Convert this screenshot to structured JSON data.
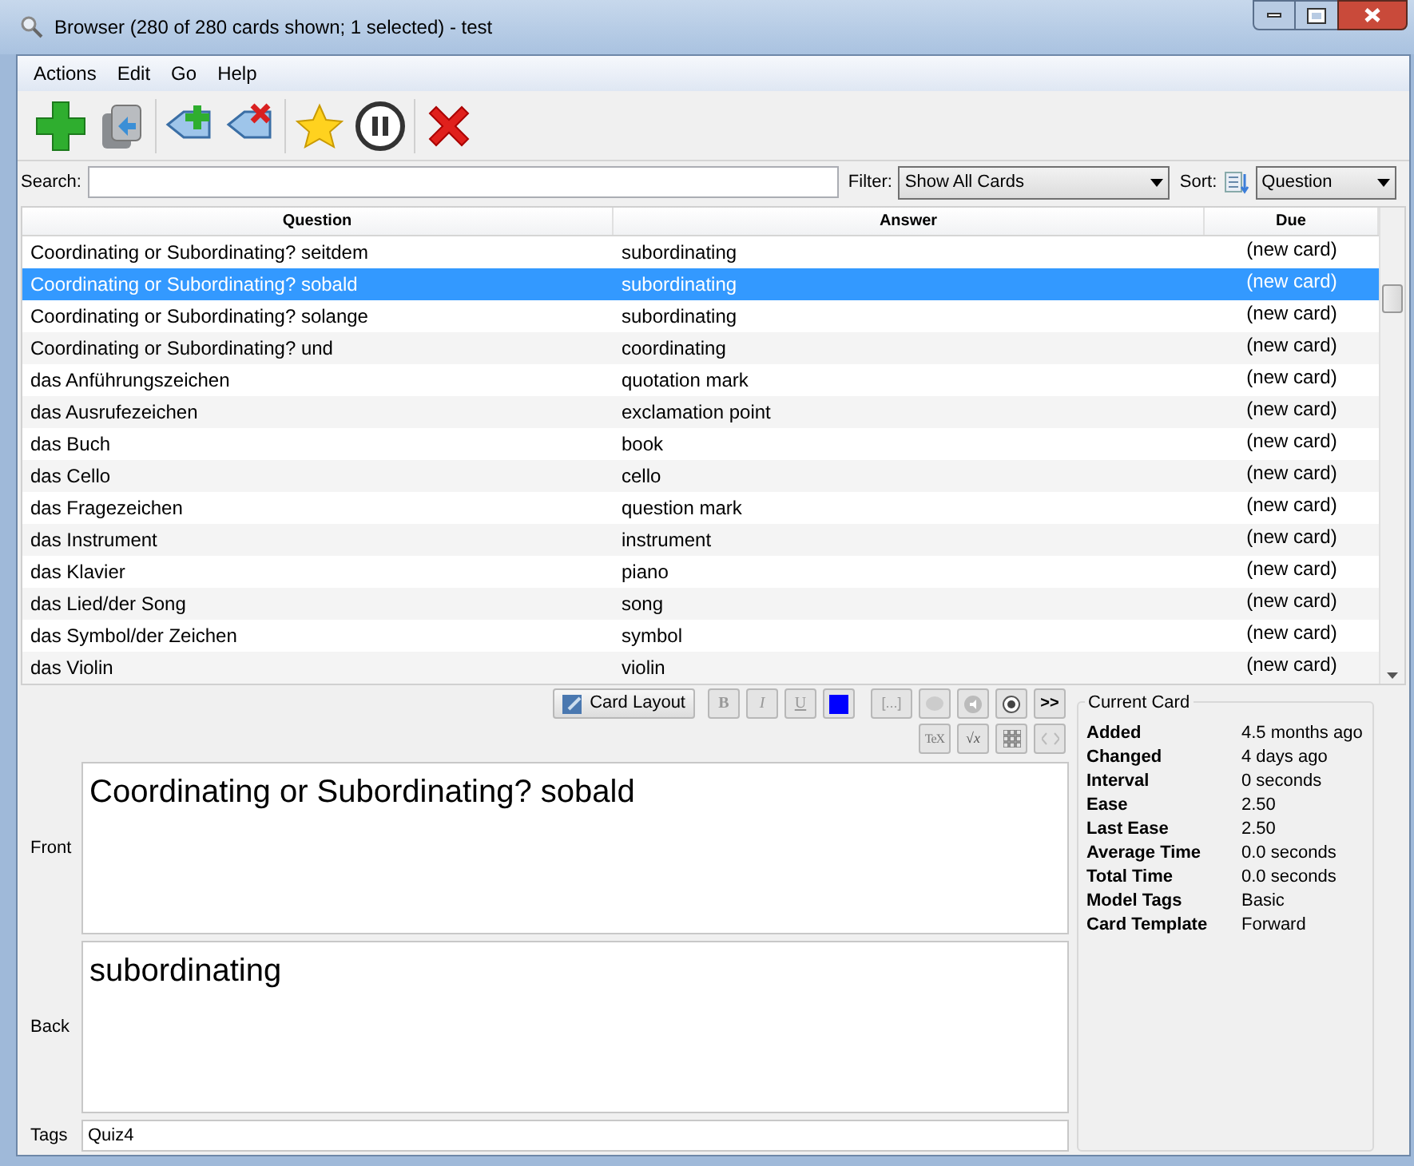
{
  "window": {
    "title": "Browser (280 of 280 cards shown; 1 selected) - test"
  },
  "menu": [
    "Actions",
    "Edit",
    "Go",
    "Help"
  ],
  "search": {
    "label": "Search:"
  },
  "filter": {
    "label": "Filter:",
    "value": "Show All Cards"
  },
  "sort": {
    "label": "Sort:",
    "value": "Question"
  },
  "table": {
    "columns": [
      "Question",
      "Answer",
      "Due"
    ],
    "rows": [
      {
        "question": "Coordinating or Subordinating? seitdem",
        "answer": "subordinating",
        "due": "(new card)",
        "selected": false
      },
      {
        "question": "Coordinating or Subordinating? sobald",
        "answer": "subordinating",
        "due": "(new card)",
        "selected": true
      },
      {
        "question": "Coordinating or Subordinating? solange",
        "answer": "subordinating",
        "due": "(new card)",
        "selected": false
      },
      {
        "question": "Coordinating or Subordinating? und",
        "answer": "coordinating",
        "due": "(new card)",
        "selected": false
      },
      {
        "question": "das Anführungszeichen",
        "answer": "quotation mark",
        "due": "(new card)",
        "selected": false
      },
      {
        "question": "das Ausrufezeichen",
        "answer": "exclamation point",
        "due": "(new card)",
        "selected": false
      },
      {
        "question": "das Buch",
        "answer": "book",
        "due": "(new card)",
        "selected": false
      },
      {
        "question": "das Cello",
        "answer": "cello",
        "due": "(new card)",
        "selected": false
      },
      {
        "question": "das Fragezeichen",
        "answer": "question mark",
        "due": "(new card)",
        "selected": false
      },
      {
        "question": "das Instrument",
        "answer": "instrument",
        "due": "(new card)",
        "selected": false
      },
      {
        "question": "das Klavier",
        "answer": "piano",
        "due": "(new card)",
        "selected": false
      },
      {
        "question": "das Lied/der Song",
        "answer": "song",
        "due": "(new card)",
        "selected": false
      },
      {
        "question": "das Symbol/der Zeichen",
        "answer": "symbol",
        "due": "(new card)",
        "selected": false
      },
      {
        "question": "das Violin",
        "answer": "violin",
        "due": "(new card)",
        "selected": false
      }
    ]
  },
  "editor": {
    "card_layout": "Card Layout",
    "format_buttons": [
      "B",
      "I",
      "U"
    ],
    "cloze": "[...]",
    "more": ">>",
    "latex_label": "TeX",
    "math": "√x",
    "fields": [
      {
        "label": "Front",
        "value": "Coordinating or Subordinating? sobald"
      },
      {
        "label": "Back",
        "value": "subordinating"
      }
    ],
    "tags": {
      "label": "Tags",
      "value": "Quiz4"
    }
  },
  "current_card": {
    "title": "Current Card",
    "rows": [
      {
        "label": "Added",
        "value": "4.5 months ago"
      },
      {
        "label": "Changed",
        "value": "4 days ago"
      },
      {
        "label": "Interval",
        "value": "0 seconds"
      },
      {
        "label": "Ease",
        "value": "2.50"
      },
      {
        "label": "Last Ease",
        "value": "2.50"
      },
      {
        "label": "Average Time",
        "value": "0.0 seconds"
      },
      {
        "label": "Total Time",
        "value": "0.0 seconds"
      },
      {
        "label": "Model Tags",
        "value": "Basic"
      },
      {
        "label": "Card Template",
        "value": "Forward"
      }
    ]
  }
}
